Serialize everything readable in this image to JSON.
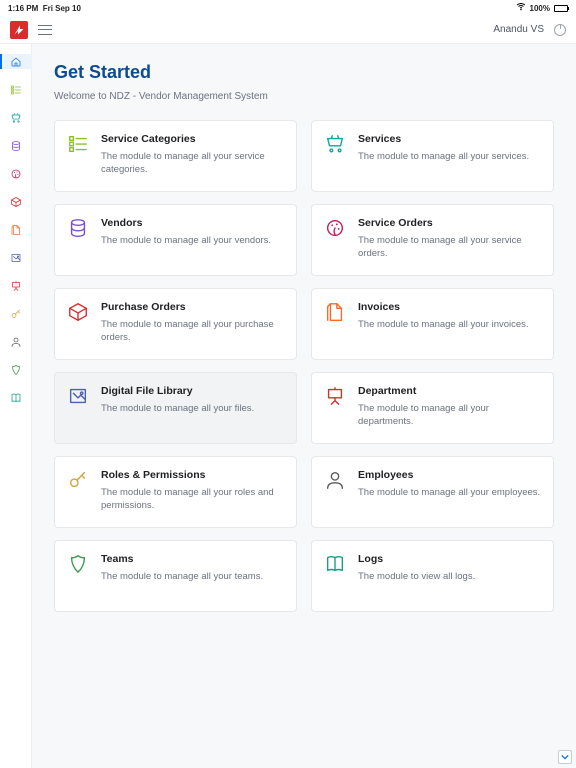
{
  "statusbar": {
    "time": "1:16 PM",
    "date": "Fri Sep 10",
    "battery": "100%"
  },
  "topbar": {
    "username": "Anandu VS"
  },
  "sidebar": {
    "items": [
      {
        "name": "home",
        "color": "#0a6de0"
      },
      {
        "name": "categories",
        "color": "#8bbf2a"
      },
      {
        "name": "services",
        "color": "#0fa3a3"
      },
      {
        "name": "vendors",
        "color": "#7b4cd6"
      },
      {
        "name": "service-orders",
        "color": "#c2185b"
      },
      {
        "name": "purchase-orders",
        "color": "#d92c2c"
      },
      {
        "name": "invoices",
        "color": "#f26d2a"
      },
      {
        "name": "files",
        "color": "#4a61b0"
      },
      {
        "name": "department",
        "color": "#d92c2c"
      },
      {
        "name": "roles",
        "color": "#d4a13c"
      },
      {
        "name": "employees",
        "color": "#5c5c5c"
      },
      {
        "name": "teams",
        "color": "#3f9b4f"
      },
      {
        "name": "logs",
        "color": "#15a085"
      }
    ]
  },
  "page": {
    "title": "Get Started",
    "subtitle": "Welcome to NDZ - Vendor Management System"
  },
  "cards": [
    {
      "key": "service-categories",
      "title": "Service Categories",
      "desc": "The module to manage all your service categories.",
      "color": "#8bbf2a",
      "icon": "grid"
    },
    {
      "key": "services",
      "title": "Services",
      "desc": "The module to manage all your services.",
      "color": "#0fa3a3",
      "icon": "cart"
    },
    {
      "key": "vendors",
      "title": "Vendors",
      "desc": "The module to manage all your vendors.",
      "color": "#7b4cd6",
      "icon": "db"
    },
    {
      "key": "service-orders",
      "title": "Service Orders",
      "desc": "The module to manage all your service orders.",
      "color": "#c2185b",
      "icon": "palette"
    },
    {
      "key": "purchase-orders",
      "title": "Purchase Orders",
      "desc": "The module to manage all your purchase orders.",
      "color": "#d92c2c",
      "icon": "box"
    },
    {
      "key": "invoices",
      "title": "Invoices",
      "desc": "The module to manage all your invoices.",
      "color": "#f26d2a",
      "icon": "file"
    },
    {
      "key": "digital-file-library",
      "title": "Digital File Library",
      "desc": "The module to manage all your files.",
      "color": "#4a61b0",
      "icon": "image",
      "highlight": true
    },
    {
      "key": "department",
      "title": "Department",
      "desc": "The module to manage all your departments.",
      "color": "#d92c2c",
      "icon": "easel"
    },
    {
      "key": "roles-permissions",
      "title": "Roles & Permissions",
      "desc": "The module to manage all your roles and permissions.",
      "color": "#d4a13c",
      "icon": "key"
    },
    {
      "key": "employees",
      "title": "Employees",
      "desc": "The module to manage all your employees.",
      "color": "#5c5c5c",
      "icon": "user"
    },
    {
      "key": "teams",
      "title": "Teams",
      "desc": "The module to manage all your teams.",
      "color": "#3f9b4f",
      "icon": "shield"
    },
    {
      "key": "logs",
      "title": "Logs",
      "desc": "The module to view all logs.",
      "color": "#15a085",
      "icon": "book"
    }
  ]
}
